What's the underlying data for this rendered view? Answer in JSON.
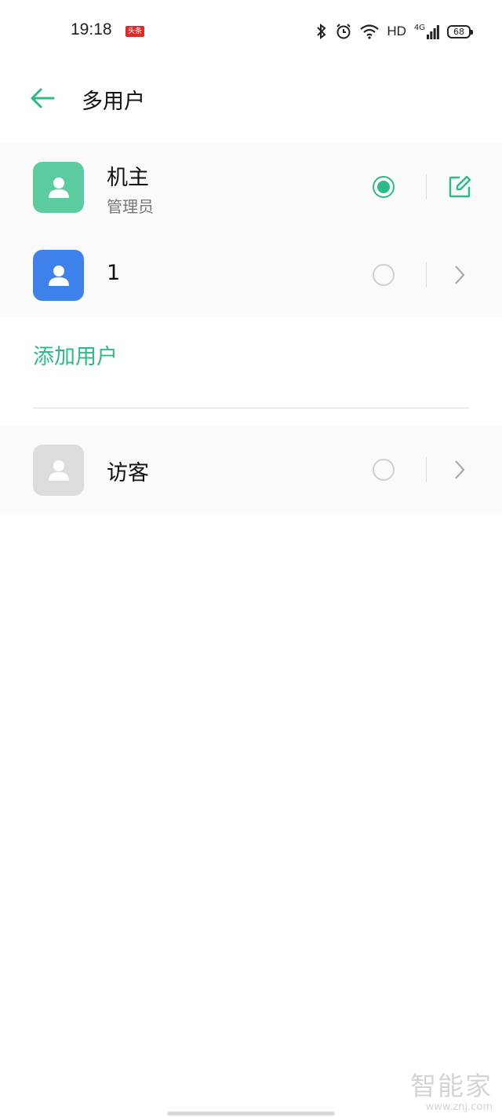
{
  "status_bar": {
    "time": "19:18",
    "app_badge": "头条",
    "network": "HD",
    "signal_label": "4G",
    "battery": "68",
    "icons": [
      "bluetooth-icon",
      "alarm-icon",
      "wifi-icon",
      "signal-icon",
      "battery-icon"
    ]
  },
  "header": {
    "title": "多用户",
    "back_icon": "back-arrow-icon"
  },
  "users": [
    {
      "name": "机主",
      "subtitle": "管理员",
      "selected": true,
      "avatar_color": "#5ccba0",
      "action_icon": "edit-icon"
    },
    {
      "name": "1",
      "subtitle": "",
      "selected": false,
      "avatar_color": "#3f81ea",
      "action_icon": "chevron-right-icon"
    }
  ],
  "add_user_label": "添加用户",
  "guest": {
    "name": "访客",
    "selected": false,
    "avatar_color": "#dcdcdc",
    "action_icon": "chevron-right-icon"
  },
  "watermark": {
    "big": "智能家",
    "small": "www.znj.com"
  },
  "colors": {
    "accent": "#2dbb85",
    "divider": "#dcdcdc"
  }
}
